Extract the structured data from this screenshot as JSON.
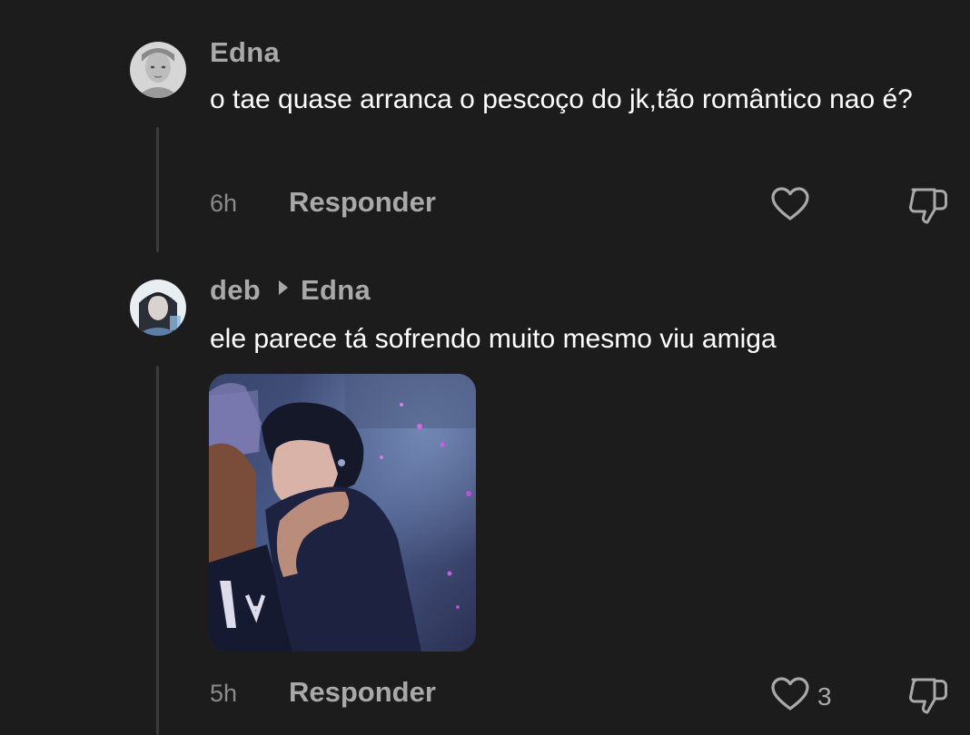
{
  "comments": [
    {
      "author": "Edna",
      "text": "o tae quase arranca o pescoço do jk,tão romântico nao é?",
      "time": "6h",
      "reply_label": "Responder",
      "likes": ""
    },
    {
      "author": "deb",
      "reply_to": "Edna",
      "text": "ele parece tá sofrendo muito mesmo viu amiga",
      "time": "5h",
      "reply_label": "Responder",
      "likes": "3"
    }
  ],
  "icons": {
    "like": "heart-outline-icon",
    "dislike": "thumbs-down-icon",
    "reply_target": "triangle-right-icon"
  },
  "colors": {
    "background": "#1c1c1c",
    "text": "#ffffff",
    "username": "#a9a9a9",
    "meta": "#8b8b8b"
  }
}
